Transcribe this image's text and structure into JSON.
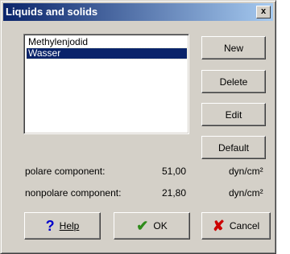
{
  "window": {
    "title": "Liquids and solids",
    "close_label": "x"
  },
  "list": {
    "items": [
      "Methylenjodid",
      "Wasser"
    ],
    "selected_index": 1
  },
  "buttons": {
    "new": "New",
    "delete": "Delete",
    "edit": "Edit",
    "default": "Default",
    "help": "Help",
    "ok": "OK",
    "cancel": "Cancel"
  },
  "values": {
    "polar_label": "polare component:",
    "polar_value": "51,00",
    "polar_unit": "dyn/cm²",
    "nonpolar_label": "nonpolare component:",
    "nonpolar_value": "21,80",
    "nonpolar_unit": "dyn/cm²"
  },
  "icons": {
    "help": "question-icon",
    "ok": "checkmark-icon",
    "cancel": "x-icon"
  },
  "colors": {
    "title_start": "#0a246a",
    "title_end": "#a6caf0",
    "selection": "#0a246a",
    "help_icon": "#0000cc",
    "ok_icon": "#2e8b1a",
    "cancel_icon": "#cc0000"
  }
}
